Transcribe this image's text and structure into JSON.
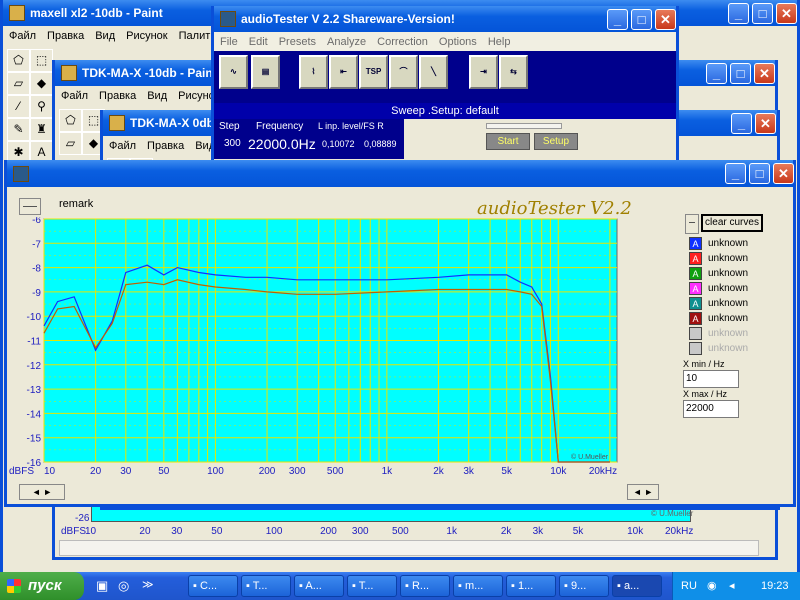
{
  "paint1": {
    "title": "maxell xl2 -10db - Paint",
    "menu": [
      "Файл",
      "Правка",
      "Вид",
      "Рисунок",
      "Палит"
    ]
  },
  "paint2": {
    "title": "TDK-MA-X -10db - Paint",
    "menu": [
      "Файл",
      "Правка",
      "Вид",
      "Рисунок"
    ]
  },
  "paint3": {
    "title": "TDK-MA-X 0db",
    "menu": [
      "Файл",
      "Правка",
      "Вид"
    ]
  },
  "at": {
    "title": "audioTester  V 2.2 Shareware-Version!",
    "menu": [
      "File",
      "Edit",
      "Presets",
      "Analyze",
      "Correction",
      "Options",
      "Help"
    ],
    "tsp": "TSP",
    "status": "Sweep .Setup: default",
    "step_label": "Step",
    "step_value": "300",
    "freq_label": "Frequency",
    "freq_value": "22000.0Hz",
    "level_label": "L inp. level/FS R",
    "level_l": "0,10072",
    "level_r": "0,08889",
    "start": "Start",
    "setup": "Setup"
  },
  "plot": {
    "remark": "remark",
    "watermark": "audioTester V2.2",
    "clear_curves": "clear curves",
    "xmin_label": "X min / Hz",
    "xmin_value": "10",
    "xmax_label": "X max / Hz",
    "xmax_value": "22000",
    "copyright": "© U.Mueller",
    "unit": "dBFS",
    "y_ticks": [
      "-6",
      "-7",
      "-8",
      "-9",
      "-10",
      "-11",
      "-12",
      "-13",
      "-14",
      "-15",
      "-16"
    ],
    "x_ticks": [
      "10",
      "20",
      "30",
      "50",
      "100",
      "200",
      "300",
      "500",
      "1k",
      "2k",
      "3k",
      "5k",
      "10k",
      "20kHz"
    ],
    "curves": [
      {
        "ch": "A",
        "color": "#1030ff",
        "name": "unknown"
      },
      {
        "ch": "A",
        "color": "#ff2020",
        "name": "unknown"
      },
      {
        "ch": "A",
        "color": "#10a010",
        "name": "unknown"
      },
      {
        "ch": "A",
        "color": "#ff30ff",
        "name": "unknown"
      },
      {
        "ch": "A",
        "color": "#109090",
        "name": "unknown"
      },
      {
        "ch": "A",
        "color": "#a01010",
        "name": "unknown"
      },
      {
        "ch": "",
        "color": "#c8c8c8",
        "name": "unknown"
      },
      {
        "ch": "",
        "color": "#c8c8c8",
        "name": "unknown"
      }
    ]
  },
  "bg_plot": {
    "y_tick": "-26",
    "unit": "dBFS",
    "x_ticks": [
      "10",
      "20",
      "30",
      "50",
      "100",
      "200",
      "300",
      "500",
      "1k",
      "2k",
      "3k",
      "5k",
      "10k",
      "20kHz"
    ],
    "copyright": "© U.Mueller"
  },
  "chart_data": {
    "type": "line",
    "xlabel": "",
    "ylabel": "dBFS",
    "xscale": "log",
    "xlim": [
      10,
      22000
    ],
    "ylim": [
      -16,
      -6
    ],
    "grid": true,
    "series": [
      {
        "x": [
          10,
          12,
          15,
          20,
          25,
          30,
          40,
          50,
          60,
          80,
          100,
          150,
          200,
          300,
          500,
          1000,
          2000,
          3000,
          5000,
          6000,
          7000,
          8000,
          9000,
          10000,
          12000,
          14000,
          20000
        ],
        "y": [
          -10.4,
          -9.4,
          -9.2,
          -11.4,
          -10.2,
          -8.2,
          -7.9,
          -8.3,
          -8.0,
          -8.2,
          -8.3,
          -8.4,
          -8.4,
          -8.5,
          -8.5,
          -8.5,
          -8.4,
          -8.3,
          -8.3,
          -8.6,
          -8.8,
          -9.5,
          -12.5,
          -16.0,
          -16.0,
          -16.0,
          -16.0
        ],
        "color": "#1030ff"
      },
      {
        "x": [
          10,
          12,
          15,
          20,
          25,
          30,
          40,
          50,
          60,
          80,
          100,
          150,
          200,
          300,
          500,
          1000,
          2000,
          3000,
          5000,
          6000,
          7000,
          8000,
          9000,
          10000,
          12000,
          14000,
          20000
        ],
        "y": [
          -10.7,
          -9.7,
          -9.6,
          -11.3,
          -10.3,
          -8.7,
          -8.6,
          -8.7,
          -8.5,
          -8.7,
          -8.8,
          -8.9,
          -9.0,
          -9.1,
          -9.1,
          -9.0,
          -8.9,
          -8.9,
          -8.9,
          -9.0,
          -9.1,
          -9.6,
          -12.7,
          -16.0,
          -16.0,
          -16.0,
          -16.0
        ],
        "color": "#c06000"
      }
    ]
  },
  "taskbar": {
    "start": "пуск",
    "items": [
      "C...",
      "T...",
      "A...",
      "T...",
      "R...",
      "m...",
      "1...",
      "9...",
      "a..."
    ],
    "lang": "RU",
    "clock": "19:23"
  }
}
